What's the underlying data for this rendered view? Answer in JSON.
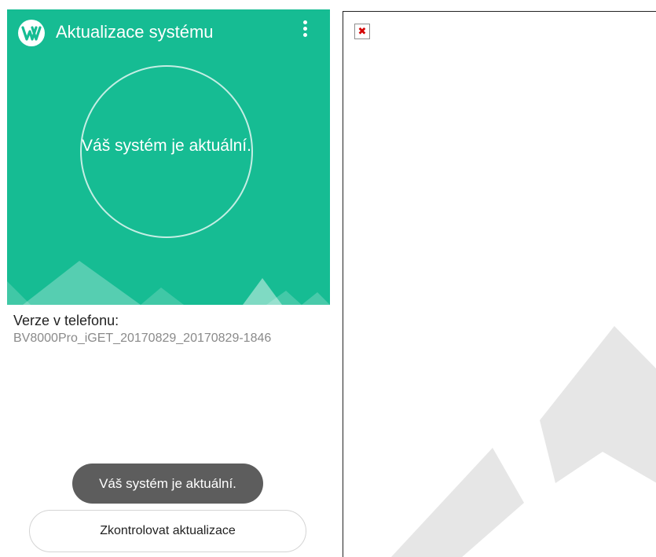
{
  "app": {
    "title": "Aktualizace systému",
    "accent_color": "#16bc93",
    "logo_icon": "update-logo-icon",
    "menu_icon": "more-vert-icon"
  },
  "status": {
    "message": "Váš systém je aktuální."
  },
  "version": {
    "label": "Verze v telefonu:",
    "value": "BV8000Pro_iGET_20170829_20170829-1846"
  },
  "toast": {
    "message": "Váš systém je aktuální."
  },
  "actions": {
    "check_updates": "Zkontrolovat aktualizace"
  },
  "image_panel": {
    "broken_image_icon": "broken-image-icon",
    "broken_icon_glyph": "✖"
  }
}
